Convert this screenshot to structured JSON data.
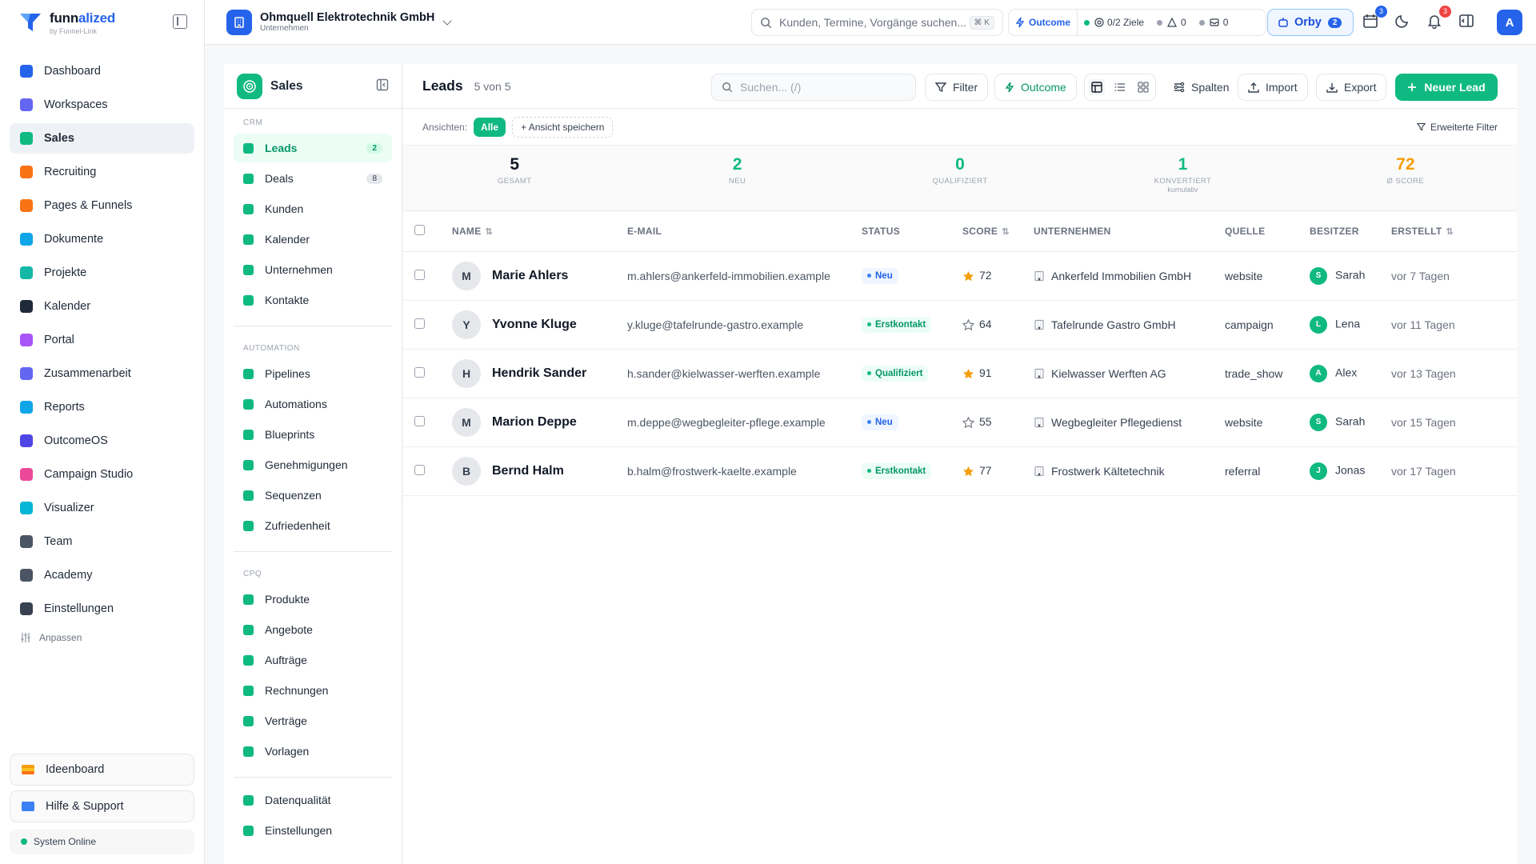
{
  "brand": {
    "name_a": "funn",
    "name_b": "alized",
    "sub": "by Funnel-Link"
  },
  "nav": {
    "items": [
      {
        "label": "Dashboard",
        "icon": "dashboard-icon",
        "color": "#2563eb"
      },
      {
        "label": "Workspaces",
        "icon": "workspaces-icon",
        "color": "#6366f1"
      },
      {
        "label": "Sales",
        "icon": "sales-icon",
        "color": "#10b981",
        "active": true
      },
      {
        "label": "Recruiting",
        "icon": "recruiting-icon",
        "color": "#f97316"
      },
      {
        "label": "Pages & Funnels",
        "icon": "funnel-icon",
        "color": "#f97316"
      },
      {
        "label": "Dokumente",
        "icon": "document-icon",
        "color": "#0ea5e9"
      },
      {
        "label": "Projekte",
        "icon": "projects-icon",
        "color": "#14b8a6"
      },
      {
        "label": "Kalender",
        "icon": "calendar-icon",
        "color": "#1f2937"
      },
      {
        "label": "Portal",
        "icon": "portal-icon",
        "color": "#a855f7"
      },
      {
        "label": "Zusammenarbeit",
        "icon": "collaboration-icon",
        "color": "#6366f1"
      },
      {
        "label": "Reports",
        "icon": "reports-icon",
        "color": "#0ea5e9"
      },
      {
        "label": "OutcomeOS",
        "icon": "outcome-icon",
        "color": "#4f46e5"
      },
      {
        "label": "Campaign Studio",
        "icon": "campaign-icon",
        "color": "#ec4899"
      },
      {
        "label": "Visualizer",
        "icon": "visualizer-icon",
        "color": "#06b6d4"
      },
      {
        "label": "Team",
        "icon": "team-icon",
        "color": "#4b5563"
      },
      {
        "label": "Academy",
        "icon": "academy-icon",
        "color": "#4b5563"
      },
      {
        "label": "Einstellungen",
        "icon": "settings-icon",
        "color": "#374151"
      }
    ],
    "customize": "Anpassen",
    "ideaboard": "Ideenboard",
    "help": "Hilfe & Support",
    "system_status": "System Online"
  },
  "topbar": {
    "company": "Ohmquell Elektrotechnik GmbH",
    "company_sub": "Unternehmen",
    "search_placeholder": "Kunden, Termine, Vorgänge suchen...",
    "search_kbd": "⌘ K",
    "outcome": "Outcome",
    "goals": "0/2 Ziele",
    "warnings": "0",
    "messages": "0",
    "orby": "Orby",
    "orby_count": "2",
    "calendar_badge": "3",
    "notif_badge": "3",
    "avatar": "A"
  },
  "subnav": {
    "title": "Sales",
    "sections": [
      {
        "label": "CRM",
        "items": [
          {
            "label": "Leads",
            "count": "2",
            "active": true
          },
          {
            "label": "Deals",
            "count": "8"
          },
          {
            "label": "Kunden"
          },
          {
            "label": "Kalender"
          },
          {
            "label": "Unternehmen"
          },
          {
            "label": "Kontakte"
          }
        ]
      },
      {
        "label": "AUTOMATION",
        "items": [
          {
            "label": "Pipelines"
          },
          {
            "label": "Automations"
          },
          {
            "label": "Blueprints"
          },
          {
            "label": "Genehmigungen"
          },
          {
            "label": "Sequenzen"
          },
          {
            "label": "Zufriedenheit"
          }
        ]
      },
      {
        "label": "CPQ",
        "items": [
          {
            "label": "Produkte"
          },
          {
            "label": "Angebote"
          },
          {
            "label": "Aufträge"
          },
          {
            "label": "Rechnungen"
          },
          {
            "label": "Verträge"
          },
          {
            "label": "Vorlagen"
          }
        ]
      },
      {
        "label": "",
        "items": [
          {
            "label": "Datenqualität"
          },
          {
            "label": "Einstellungen"
          }
        ]
      }
    ]
  },
  "leads": {
    "title": "Leads",
    "count_text": "5 von 5",
    "search_placeholder": "Suchen... (/)",
    "filter": "Filter",
    "outcome": "Outcome",
    "columns_btn": "Spalten",
    "import": "Import",
    "export": "Export",
    "new_lead": "Neuer Lead",
    "views_label": "Ansichten:",
    "view_all": "Alle",
    "save_view": "Ansicht speichern",
    "advanced_filter": "Erweiterte Filter",
    "stats": [
      {
        "value": "5",
        "label": "GESAMT",
        "color": "#111827"
      },
      {
        "value": "2",
        "label": "NEU",
        "color": "#10b981"
      },
      {
        "value": "0",
        "label": "QUALIFIZIERT",
        "color": "#10b981"
      },
      {
        "value": "1",
        "label": "KONVERTIERT",
        "sub": "kumulativ",
        "color": "#10b981"
      },
      {
        "value": "72",
        "label": "Ø SCORE",
        "color": "#f59e0b"
      }
    ],
    "headers": {
      "name": "NAME",
      "email": "E-MAIL",
      "status": "STATUS",
      "score": "SCORE",
      "company": "UNTERNEHMEN",
      "source": "QUELLE",
      "owner": "BESITZER",
      "created": "ERSTELLT"
    },
    "rows": [
      {
        "initial": "M",
        "name": "Marie Ahlers",
        "email": "m.ahlers@ankerfeld-immobilien.example",
        "status": "Neu",
        "status_kind": "neu",
        "score": "72",
        "starred": true,
        "company": "Ankerfeld Immobilien GmbH",
        "source": "website",
        "owner_initial": "S",
        "owner": "Sarah",
        "created": "vor 7 Tagen"
      },
      {
        "initial": "Y",
        "name": "Yvonne Kluge",
        "email": "y.kluge@tafelrunde-gastro.example",
        "status": "Erstkontakt",
        "status_kind": "erst",
        "score": "64",
        "starred": false,
        "company": "Tafelrunde Gastro GmbH",
        "source": "campaign",
        "owner_initial": "L",
        "owner": "Lena",
        "created": "vor 11 Tagen"
      },
      {
        "initial": "H",
        "name": "Hendrik Sander",
        "email": "h.sander@kielwasser-werften.example",
        "status": "Qualifiziert",
        "status_kind": "erst",
        "score": "91",
        "starred": true,
        "company": "Kielwasser Werften AG",
        "source": "trade_show",
        "owner_initial": "A",
        "owner": "Alex",
        "created": "vor 13 Tagen"
      },
      {
        "initial": "M",
        "name": "Marion Deppe",
        "email": "m.deppe@wegbegleiter-pflege.example",
        "status": "Neu",
        "status_kind": "neu",
        "score": "55",
        "starred": false,
        "company": "Wegbegleiter Pflegedienst",
        "source": "website",
        "owner_initial": "S",
        "owner": "Sarah",
        "created": "vor 15 Tagen"
      },
      {
        "initial": "B",
        "name": "Bernd Halm",
        "email": "b.halm@frostwerk-kaelte.example",
        "status": "Erstkontakt",
        "status_kind": "erst",
        "score": "77",
        "starred": true,
        "company": "Frostwerk Kältetechnik",
        "source": "referral",
        "owner_initial": "J",
        "owner": "Jonas",
        "created": "vor 17 Tagen"
      }
    ]
  }
}
